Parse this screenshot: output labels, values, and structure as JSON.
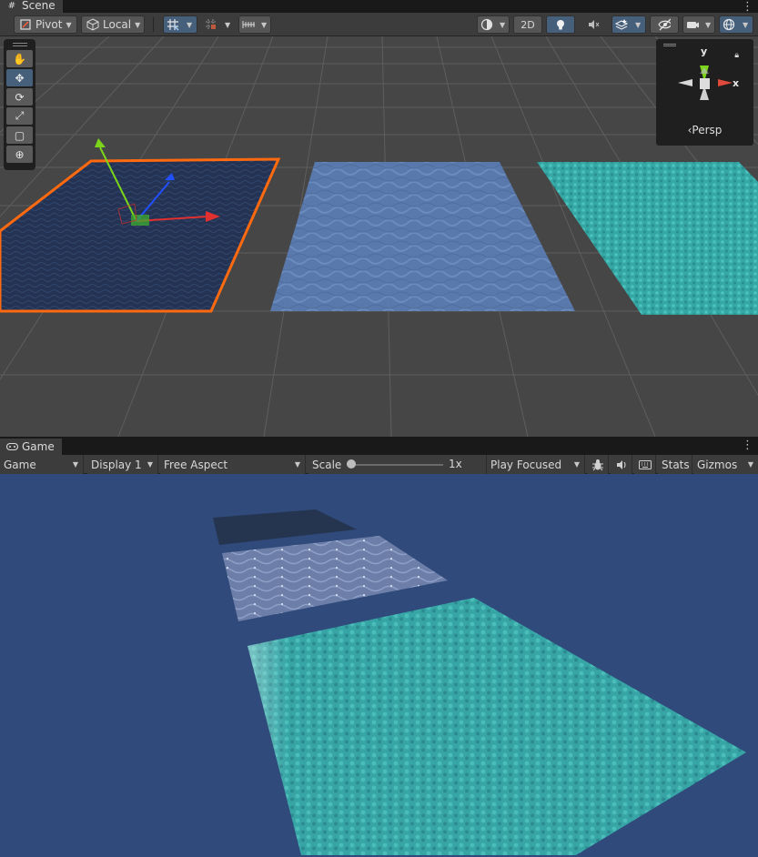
{
  "scene": {
    "tab_label": "Scene",
    "toolbar": {
      "pivot_label": "Pivot",
      "local_label": "Local",
      "twod_label": "2D"
    },
    "gizmo": {
      "y_label": "y",
      "x_label": "x",
      "persp_label": "‹Persp"
    }
  },
  "game": {
    "tab_label": "Game",
    "toolbar": {
      "game_select": "Game",
      "display_select": "Display 1",
      "aspect_select": "Free Aspect",
      "scale_label": "Scale",
      "scale_value": "1x",
      "scale_fraction": 0,
      "play_mode_select": "Play Focused",
      "stats_label": "Stats",
      "gizmos_label": "Gizmos"
    }
  },
  "colors": {
    "scene_background": "#464646",
    "game_background": "#2f4a7b",
    "selection_outline": "#ff6a10",
    "active_button": "#46607c",
    "dark_water": "#233252",
    "blue_water": "#5b7db3",
    "teal_water": "#3bb0ac"
  },
  "icons": {
    "tools": [
      "hand-icon",
      "move-icon",
      "rotate-icon",
      "scale-icon",
      "rect-icon",
      "transform-icon"
    ]
  }
}
